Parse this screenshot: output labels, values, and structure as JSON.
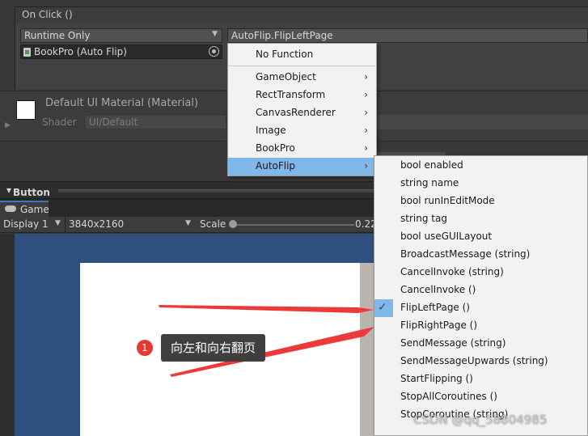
{
  "inspector": {
    "on_click_header": "On Click ()",
    "runtime_select": "Runtime Only",
    "function_select": "AutoFlip.FlipLeftPage",
    "object_field": "BookPro (Auto Flip)",
    "material_title": "Default UI Material (Material)",
    "shader_label": "Shader",
    "shader_value": "UI/Default"
  },
  "toolbar": {
    "button_tab": "Button"
  },
  "game": {
    "tab_label": "Game",
    "display_label": "Display 1",
    "resolution_label": "3840x2160",
    "scale_label": "Scale",
    "scale_value": "0.22"
  },
  "menu_primary": {
    "items": [
      {
        "label": "No Function",
        "submenu": false
      },
      {
        "label": "GameObject",
        "submenu": true
      },
      {
        "label": "RectTransform",
        "submenu": true
      },
      {
        "label": "CanvasRenderer",
        "submenu": true
      },
      {
        "label": "Image",
        "submenu": true
      },
      {
        "label": "BookPro",
        "submenu": true
      },
      {
        "label": "AutoFlip",
        "submenu": true,
        "selected": true
      }
    ],
    "chevron": "›"
  },
  "menu_autoflip": {
    "items": [
      {
        "label": "bool enabled"
      },
      {
        "label": "string name"
      },
      {
        "label": "bool runInEditMode"
      },
      {
        "label": "string tag"
      },
      {
        "label": "bool useGUILayout"
      },
      {
        "label": "BroadcastMessage (string)"
      },
      {
        "label": "CancelInvoke (string)"
      },
      {
        "label": "CancelInvoke ()"
      },
      {
        "label": "FlipLeftPage ()",
        "checked": true
      },
      {
        "label": "FlipRightPage ()"
      },
      {
        "label": "SendMessage (string)"
      },
      {
        "label": "SendMessageUpwards (string)"
      },
      {
        "label": "StartFlipping ()"
      },
      {
        "label": "StopAllCoroutines ()"
      },
      {
        "label": "StopCoroutine (string)"
      }
    ],
    "check_glyph": "✓"
  },
  "annotation": {
    "number": "1",
    "label": "向左和向右翻页"
  },
  "watermark": "CSDN @qq_58804985",
  "colors": {
    "menu_highlight": "#7fb7e8",
    "annotation_red": "#e53935",
    "game_background": "#2f4f7f"
  }
}
